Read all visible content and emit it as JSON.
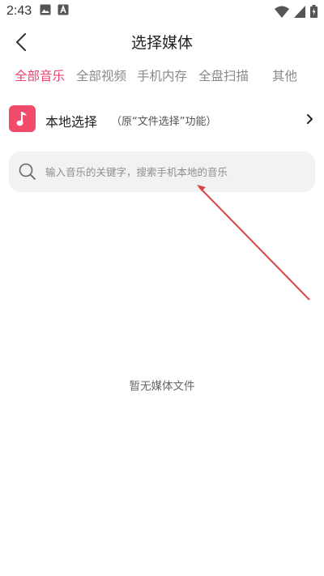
{
  "status_bar": {
    "time": "2:43",
    "left_icons": [
      "image-icon",
      "a-box-icon"
    ],
    "right_icons": [
      "wifi-icon",
      "signal-icon",
      "battery-icon"
    ]
  },
  "header": {
    "title": "选择媒体",
    "back_icon": "chevron-left-icon"
  },
  "tabs": [
    {
      "label": "全部音乐",
      "active": true
    },
    {
      "label": "全部视频",
      "active": false
    },
    {
      "label": "手机内存",
      "active": false
    },
    {
      "label": "全盘扫描",
      "active": false
    },
    {
      "label": "其他",
      "active": false
    }
  ],
  "local_select": {
    "title": "本地选择",
    "subtitle": "（原“文件选择”功能）",
    "icon": "music-note-icon",
    "icon_color": "#f14a6a"
  },
  "search": {
    "placeholder": "输入音乐的关键字，搜索手机本地的音乐",
    "value": ""
  },
  "empty_state": {
    "text": "暂无媒体文件"
  },
  "colors": {
    "accent": "#e8416c",
    "annotation": "#d64545"
  }
}
